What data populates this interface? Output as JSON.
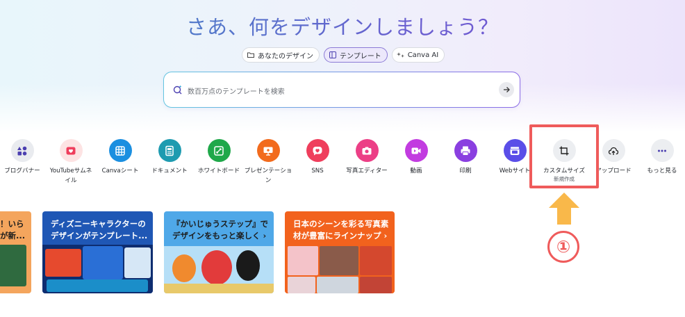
{
  "hero": {
    "title": "さあ、何をデザインしましょう？",
    "tabs": [
      {
        "label": "あなたのデザイン",
        "active": false,
        "icon": "folder-icon"
      },
      {
        "label": "テンプレート",
        "active": true,
        "icon": "template-icon"
      },
      {
        "label": "Canva AI",
        "active": false,
        "icon": "sparkle-icon"
      }
    ],
    "search": {
      "placeholder": "数百万点のテンプレートを検索"
    }
  },
  "categories": [
    {
      "label": "ブログバナー",
      "sub": "",
      "icon": "blog-banner-icon",
      "color": "#e9ebef"
    },
    {
      "label": "YouTubeサムネ",
      "sub": "イル",
      "icon": "youtube-icon",
      "color": "#fde3e3"
    },
    {
      "label": "Canvaシート",
      "sub": "",
      "icon": "sheet-icon",
      "color": "#1b8fe0"
    },
    {
      "label": "ドキュメント",
      "sub": "",
      "icon": "document-icon",
      "color": "#1e9bb0"
    },
    {
      "label": "ホワイトボード",
      "sub": "",
      "icon": "whiteboard-icon",
      "color": "#1fa84a"
    },
    {
      "label": "プレゼンテーショ",
      "sub": "ン",
      "icon": "presentation-icon",
      "color": "#f26b1d"
    },
    {
      "label": "SNS",
      "sub": "",
      "icon": "sns-heart-icon",
      "color": "#ef3e5c"
    },
    {
      "label": "写真エディター",
      "sub": "",
      "icon": "camera-icon",
      "color": "#ec3f86"
    },
    {
      "label": "動画",
      "sub": "",
      "icon": "video-icon",
      "color": "#c23ce0"
    },
    {
      "label": "印刷",
      "sub": "",
      "icon": "print-icon",
      "color": "#8a3fe0"
    },
    {
      "label": "Webサイト",
      "sub": "",
      "icon": "website-icon",
      "color": "#5a4ee8"
    },
    {
      "label": "カスタムサイズ",
      "sub": "新規作成",
      "icon": "custom-size-icon",
      "color": "#eceef1"
    },
    {
      "label": "アップロード",
      "sub": "",
      "icon": "upload-cloud-icon",
      "color": "#eceef1"
    },
    {
      "label": "もっと見る",
      "sub": "",
      "icon": "more-dots-icon",
      "color": "#eceef1"
    }
  ],
  "annotation": {
    "number": "①",
    "color": "#ef5b5b",
    "arrow_color": "#f9b84a"
  },
  "cards": [
    {
      "text_lines": [
        "！いら",
        "が新..."
      ],
      "bg": "#f4a55d"
    },
    {
      "text_lines": [
        "ディズニーキャラクターの",
        "デザインがテンプレート..."
      ],
      "bg": "#1f57b5"
    },
    {
      "text_lines": [
        "『かいじゅうステップ』で",
        "デザインをもっと楽しく ›"
      ],
      "bg": "#4fa8e8"
    },
    {
      "text_lines": [
        "日本のシーンを彩る写真素",
        "材が豊富にラインナップ ›"
      ],
      "bg": "#f2621d"
    }
  ]
}
